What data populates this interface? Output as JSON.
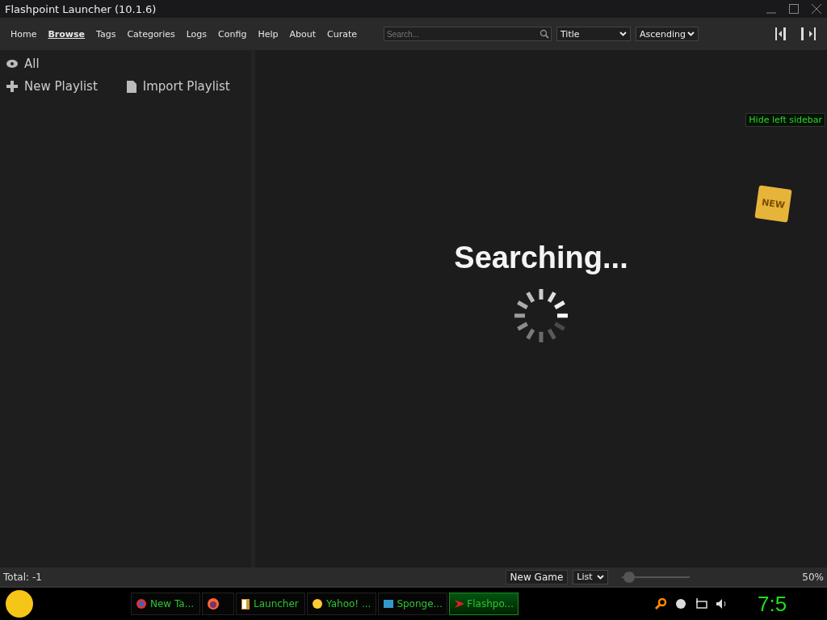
{
  "window": {
    "title": "Flashpoint Launcher (10.1.6)"
  },
  "nav": [
    {
      "label": "Home",
      "selected": false
    },
    {
      "label": "Browse",
      "selected": true
    },
    {
      "label": "Tags",
      "selected": false
    },
    {
      "label": "Categories",
      "selected": false
    },
    {
      "label": "Logs",
      "selected": false
    },
    {
      "label": "Config",
      "selected": false
    },
    {
      "label": "Help",
      "selected": false
    },
    {
      "label": "About",
      "selected": false
    },
    {
      "label": "Curate",
      "selected": false
    }
  ],
  "search": {
    "placeholder": "Search..."
  },
  "sort_field": "Title",
  "sort_order": "Ascending",
  "tooltip": "Hide left sidebar",
  "new_tag": "NEW",
  "sidebar": {
    "all": "All",
    "actions": [
      {
        "kind": "new",
        "label": "New Playlist"
      },
      {
        "kind": "import",
        "label": "Import Playlist"
      }
    ]
  },
  "main": {
    "status": "Searching..."
  },
  "footer": {
    "total": "Total: -1",
    "new_game": "New Game",
    "view": "List",
    "zoom": {
      "level": 0.1
    },
    "zoom_reading": "50%"
  },
  "taskbar": {
    "tasks": [
      {
        "kind": "browser",
        "label": "New Ta...",
        "selected": false
      },
      {
        "kind": "fox",
        "selected": false
      },
      {
        "kind": "door",
        "label": "Launcher",
        "selected": false
      },
      {
        "kind": "smile",
        "label": "Yahoo! ...",
        "selected": false
      },
      {
        "kind": "ie",
        "label": "Sponge...",
        "selected": false
      },
      {
        "kind": "flash",
        "label": "Flashpo...",
        "selected": true
      }
    ],
    "clock": "7:5"
  }
}
